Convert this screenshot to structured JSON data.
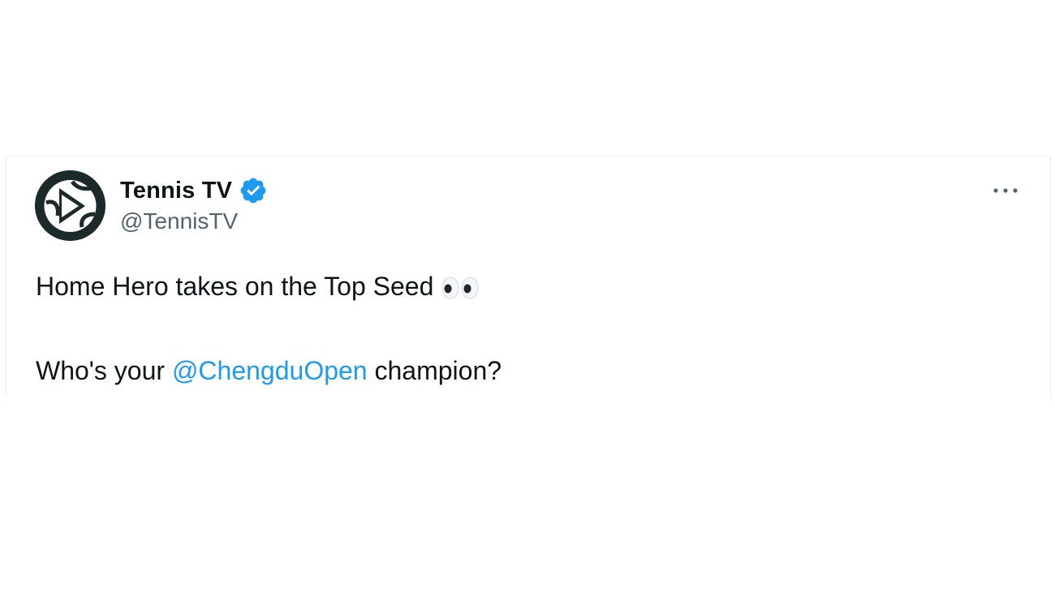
{
  "tweet": {
    "author": {
      "display_name": "Tennis TV",
      "handle": "@TennisTV",
      "verified_icon": "verified-badge-icon",
      "avatar_icon": "tennis-tv-logo"
    },
    "more_icon": "more-horizontal-icon",
    "text": {
      "line1": "Home Hero takes on the Top Seed",
      "line1_emoji": "eyes-emoji",
      "line2_before": "Who's your ",
      "line2_mention": "@ChengduOpen",
      "line2_after": " champion?"
    }
  },
  "colors": {
    "text_primary": "#0f1419",
    "text_secondary": "#536471",
    "accent": "#1d9bf0",
    "avatar_bg": "#1d2a2a"
  }
}
